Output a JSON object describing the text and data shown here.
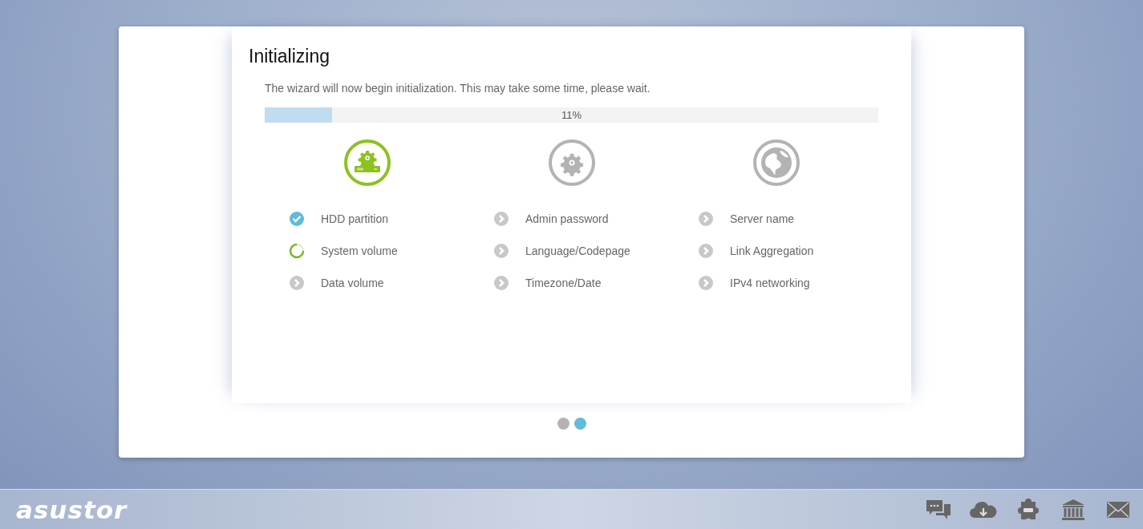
{
  "dialog": {
    "title": "Initializing",
    "message": "The wizard will now begin initialization. This may take some time, please wait.",
    "progress": {
      "level": 0.11,
      "label": "11%"
    },
    "phases": [
      {
        "kind": "storage",
        "active": true,
        "steps": [
          {
            "label": "HDD partition",
            "kind": "done"
          },
          {
            "label": "System volume",
            "kind": "running"
          },
          {
            "label": "Data volume",
            "kind": "pending"
          }
        ]
      },
      {
        "kind": "settings",
        "active": false,
        "steps": [
          {
            "label": "Admin password",
            "kind": "pending"
          },
          {
            "label": "Language/Codepage",
            "kind": "pending"
          },
          {
            "label": "Timezone/Date",
            "kind": "pending"
          }
        ]
      },
      {
        "kind": "network",
        "active": false,
        "steps": [
          {
            "label": "Server name",
            "kind": "pending"
          },
          {
            "label": "Link Aggregation",
            "kind": "pending"
          },
          {
            "label": "IPv4 networking",
            "kind": "pending"
          }
        ]
      }
    ],
    "pager": [
      {
        "selected": false
      },
      {
        "selected": true
      }
    ]
  },
  "taskbar": {
    "logo": "asustor"
  }
}
